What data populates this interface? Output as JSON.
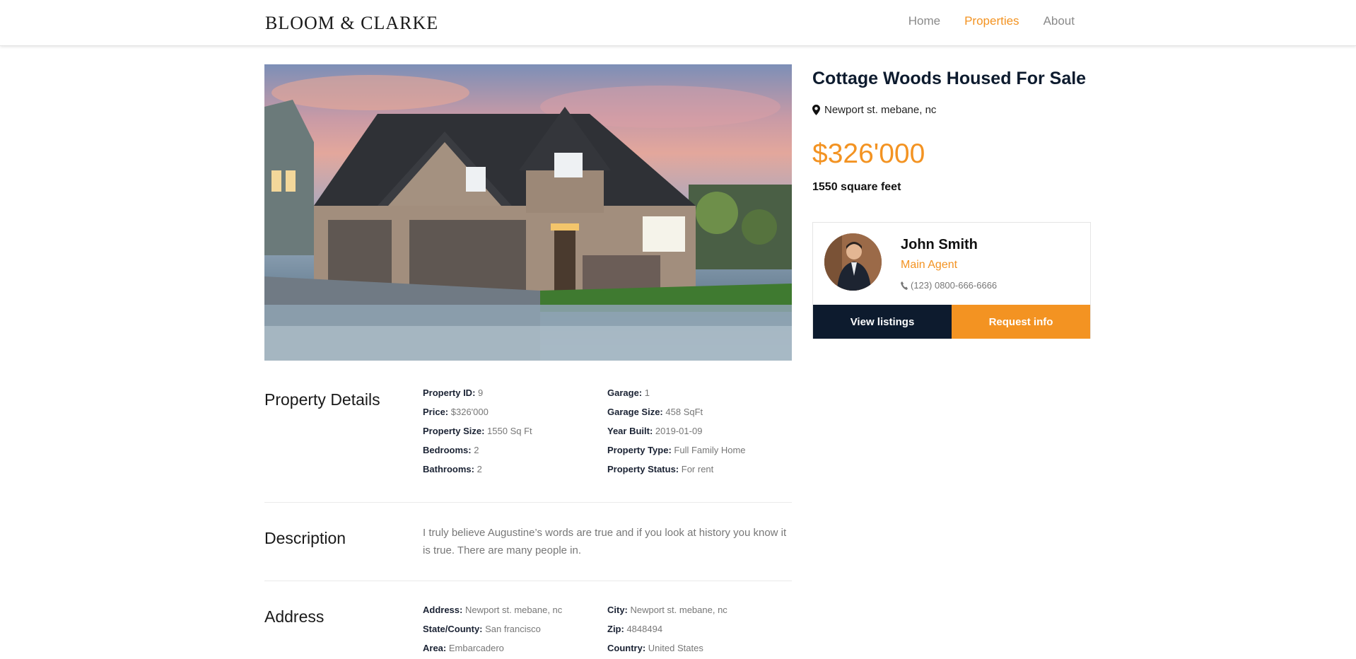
{
  "header": {
    "logo": "BLOOM & CLARKE",
    "nav": [
      {
        "label": "Home",
        "active": false
      },
      {
        "label": "Properties",
        "active": true
      },
      {
        "label": "About",
        "active": false
      }
    ]
  },
  "listing": {
    "title": "Cottage Woods Housed For Sale",
    "location": "Newport st. mebane, nc",
    "price": "$326'000",
    "area": "1550 square feet"
  },
  "agent": {
    "name": "John Smith",
    "role": "Main Agent",
    "phone": "(123) 0800-666-6666",
    "view_label": "View listings",
    "request_label": "Request info"
  },
  "details": {
    "heading": "Property Details",
    "left": [
      {
        "label": "Property ID:",
        "value": "9"
      },
      {
        "label": "Price:",
        "value": "$326'000"
      },
      {
        "label": "Property Size:",
        "value": "1550 Sq Ft"
      },
      {
        "label": "Bedrooms:",
        "value": "2"
      },
      {
        "label": "Bathrooms:",
        "value": "2"
      }
    ],
    "right": [
      {
        "label": "Garage:",
        "value": "1"
      },
      {
        "label": "Garage Size:",
        "value": "458 SqFt"
      },
      {
        "label": "Year Built:",
        "value": "2019-01-09"
      },
      {
        "label": "Property Type:",
        "value": "Full Family Home"
      },
      {
        "label": "Property Status:",
        "value": "For rent"
      }
    ]
  },
  "description": {
    "heading": "Description",
    "text": "I truly believe Augustine’s words are true and if you look at history you know it is true. There are many people in."
  },
  "address": {
    "heading": "Address",
    "left": [
      {
        "label": "Address:",
        "value": "Newport st. mebane, nc"
      },
      {
        "label": "State/County:",
        "value": "San francisco"
      },
      {
        "label": "Area:",
        "value": "Embarcadero"
      }
    ],
    "right": [
      {
        "label": "City:",
        "value": "Newport st. mebane, nc"
      },
      {
        "label": "Zip:",
        "value": "4848494"
      },
      {
        "label": "Country:",
        "value": "United States"
      }
    ]
  },
  "colors": {
    "accent": "#f39322",
    "dark": "#0d1b2e"
  }
}
